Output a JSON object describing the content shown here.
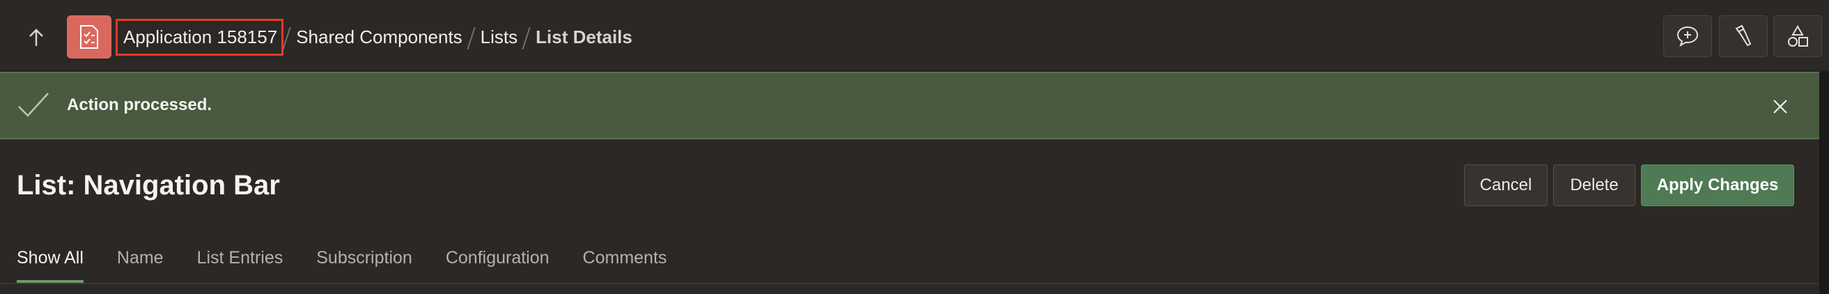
{
  "header": {
    "breadcrumb": [
      "Application 158157",
      "Shared Components",
      "Lists",
      "List Details"
    ],
    "tools": [
      "chat-plus-icon",
      "flashlight-icon",
      "shapes-icon"
    ]
  },
  "banner": {
    "message": "Action processed."
  },
  "page": {
    "title": "List: Navigation Bar"
  },
  "actions": {
    "cancel": "Cancel",
    "delete": "Delete",
    "apply": "Apply Changes"
  },
  "tabs": [
    "Show All",
    "Name",
    "List Entries",
    "Subscription",
    "Configuration",
    "Comments"
  ],
  "colors": {
    "success": "#485a40",
    "primary": "#4f7a55",
    "app_icon": "#d9695f",
    "highlight": "#e8372a"
  }
}
